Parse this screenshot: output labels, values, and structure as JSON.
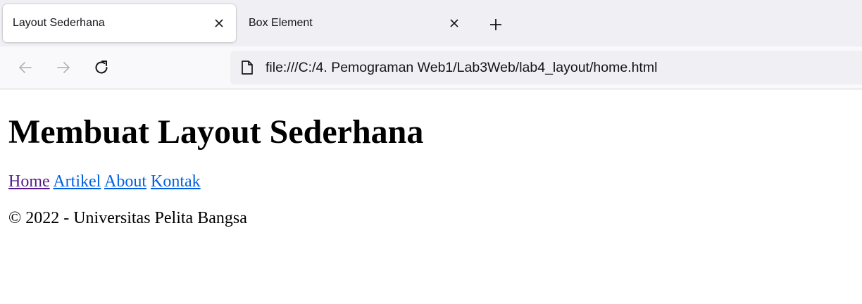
{
  "browser": {
    "tabs": [
      {
        "label": "Layout Sederhana",
        "active": true
      },
      {
        "label": "Box Element",
        "active": false
      }
    ],
    "new_tab_icon": "plus-icon",
    "nav": {
      "back_icon": "arrow-left-icon",
      "forward_icon": "arrow-right-icon",
      "reload_icon": "reload-icon"
    },
    "url": "file:///C:/4. Pemograman Web1/Lab3Web/lab4_layout/home.html",
    "page_icon": "document-icon"
  },
  "page": {
    "title": "Membuat Layout Sederhana",
    "nav_links": [
      {
        "label": "Home",
        "visited": true
      },
      {
        "label": "Artikel",
        "visited": false
      },
      {
        "label": "About",
        "visited": false
      },
      {
        "label": "Kontak",
        "visited": false
      }
    ],
    "footer": "© 2022 - Universitas Pelita Bangsa"
  },
  "colors": {
    "link": "#0060df",
    "link_visited": "#551a8b",
    "tabstrip_bg": "#f0f0f4",
    "toolbar_bg": "#f9f9fb"
  }
}
